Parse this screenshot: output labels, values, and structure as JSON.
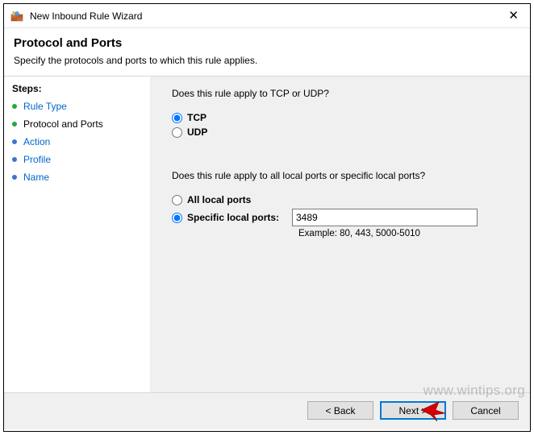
{
  "titlebar": {
    "title": "New Inbound Rule Wizard"
  },
  "header": {
    "page_title": "Protocol and Ports",
    "page_subtitle": "Specify the protocols and ports to which this rule applies."
  },
  "sidebar": {
    "steps_label": "Steps:",
    "items": [
      {
        "label": "Rule Type",
        "state": "done"
      },
      {
        "label": "Protocol and Ports",
        "state": "current"
      },
      {
        "label": "Action",
        "state": "future"
      },
      {
        "label": "Profile",
        "state": "future"
      },
      {
        "label": "Name",
        "state": "future"
      }
    ]
  },
  "main": {
    "q1": "Does this rule apply to TCP or UDP?",
    "protocol": {
      "tcp_label": "TCP",
      "udp_label": "UDP",
      "selected": "tcp"
    },
    "q2": "Does this rule apply to all local ports or specific local ports?",
    "port_scope": {
      "all_label": "All local ports",
      "specific_label": "Specific local ports:",
      "selected": "specific",
      "port_value": "3489",
      "example": "Example: 80, 443, 5000-5010"
    }
  },
  "footer": {
    "back_label": "< Back",
    "next_label": "Next >",
    "cancel_label": "Cancel"
  },
  "watermark": "www.wintips.org"
}
